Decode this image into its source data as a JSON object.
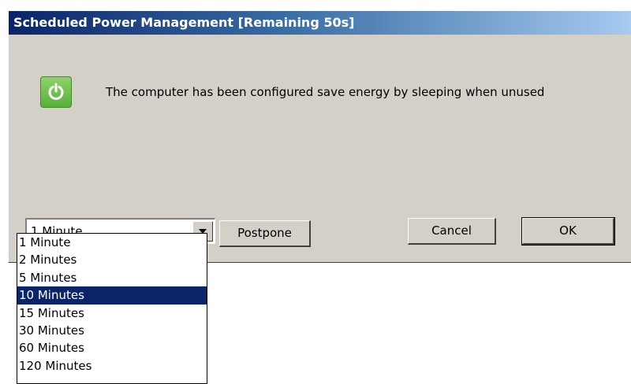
{
  "window": {
    "title": "Scheduled Power Management [Remaining 50s]"
  },
  "message": "The computer has been configured save energy by sleeping when unused",
  "icons": {
    "power": "power-icon",
    "dropdown_arrow": "chevron-down-icon"
  },
  "combo": {
    "selected_value": "1 Minute",
    "options": [
      "1 Minute",
      "2 Minutes",
      "5 Minutes",
      "10 Minutes",
      "15 Minutes",
      "30 Minutes",
      "60 Minutes",
      "120 Minutes"
    ],
    "highlighted_option": "10 Minutes"
  },
  "buttons": {
    "postpone": "Postpone",
    "cancel": "Cancel",
    "ok": "OK"
  },
  "colors": {
    "titlebar_start": "#0a246a",
    "titlebar_end": "#a6caf0",
    "dialog_bg": "#d4d0c8",
    "power_icon_green": "#6cc04a",
    "selection_bg": "#0a246a"
  }
}
